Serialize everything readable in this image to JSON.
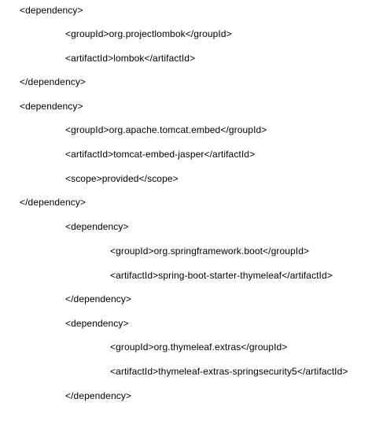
{
  "document": {
    "lines": [
      {
        "text": "<dependency>"
      },
      {
        "text": "<groupId>org.projectlombok</groupId>"
      },
      {
        "text": "<artifactId>lombok</artifactId>"
      },
      {
        "text": "</dependency>"
      },
      {
        "text": "<dependency>"
      },
      {
        "text": "<groupId>org.apache.tomcat.embed</groupId>"
      },
      {
        "text": "<artifactId>tomcat-embed-jasper</artifactId>"
      },
      {
        "text": "<scope>provided</scope>"
      },
      {
        "text": "</dependency>"
      },
      {
        "text": "<dependency>"
      },
      {
        "text": "<groupId>org.springframework.boot</groupId>"
      },
      {
        "text": "<artifactId>spring-boot-starter-thymeleaf</artifactId>"
      },
      {
        "text": "</dependency>"
      },
      {
        "text": "<dependency>"
      },
      {
        "text": "<groupId>org.thymeleaf.extras</groupId>"
      },
      {
        "text": "<artifactId>thymeleaf-extras-springsecurity5</artifactId>"
      },
      {
        "text": "</dependency>"
      }
    ]
  }
}
